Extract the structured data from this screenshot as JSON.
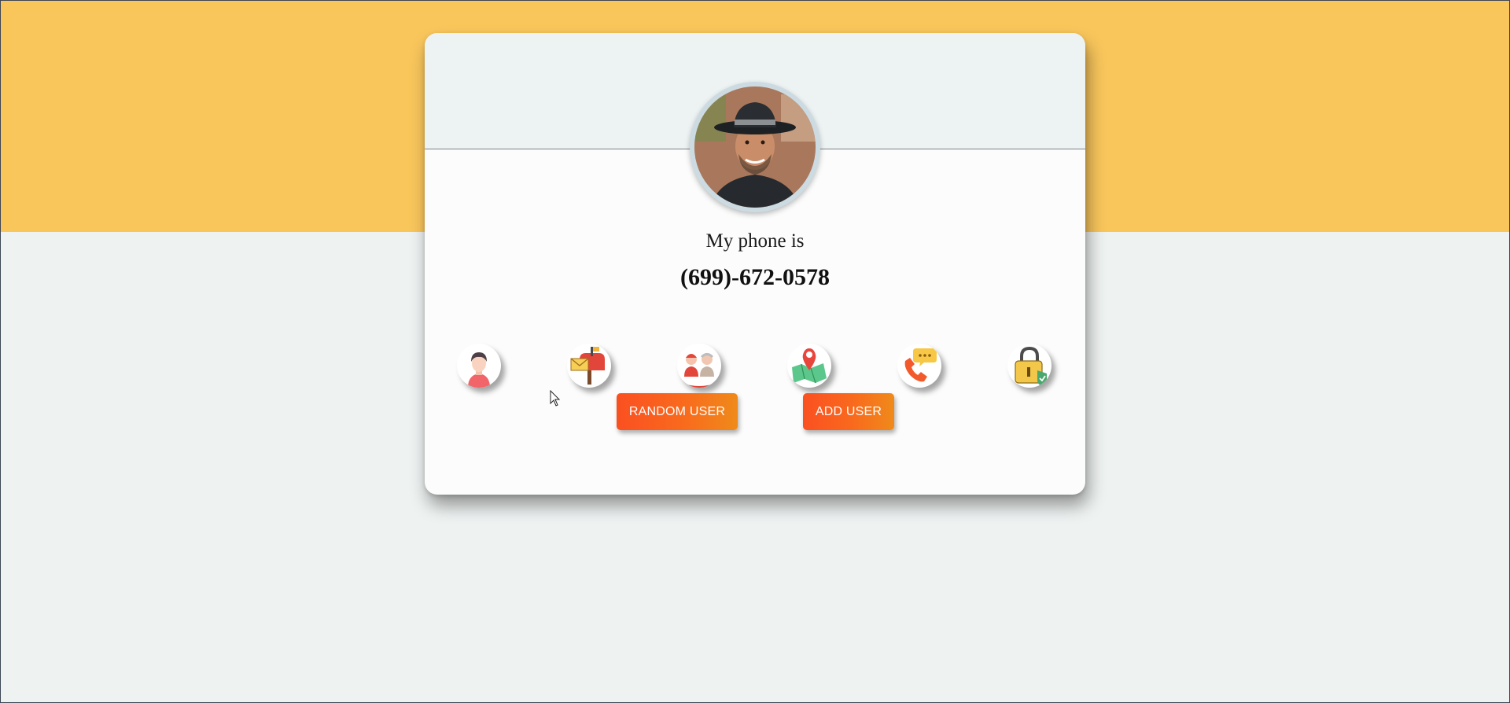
{
  "profile": {
    "label": "My phone is",
    "value": "(699)-672-0578",
    "avatar_alt": "user-avatar"
  },
  "info_icons": [
    {
      "name": "user-icon"
    },
    {
      "name": "mailbox-icon"
    },
    {
      "name": "age-icon"
    },
    {
      "name": "map-location-icon"
    },
    {
      "name": "phone-call-icon"
    },
    {
      "name": "padlock-icon"
    }
  ],
  "actions": {
    "random_user_label": "RANDOM USER",
    "add_user_label": "ADD USER"
  },
  "colors": {
    "top_band": "#f9c65c",
    "page_background": "#eef2f1",
    "card_background": "#fbfcfb",
    "button_gradient_start": "#fa5021",
    "button_gradient_end": "#ef8a1a"
  }
}
